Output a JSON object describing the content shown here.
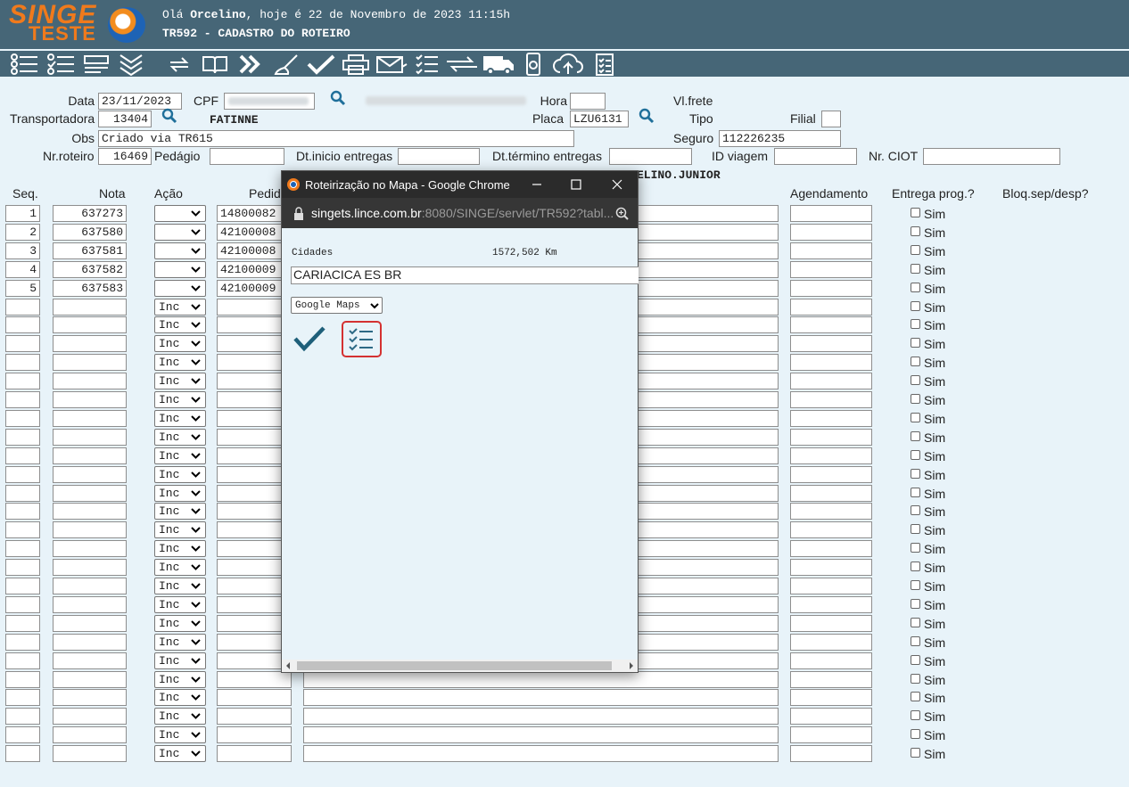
{
  "header": {
    "logo_top": "SINGE",
    "logo_bottom": "TESTE",
    "greeting_prefix": "Olá ",
    "user": "Orcelino",
    "greeting_suffix": ", hoje é 22 de Novembro de 2023 11:15h",
    "screen_title": "TR592 - CADASTRO DO ROTEIRO"
  },
  "toolbar": {
    "icons": [
      "list-icon",
      "checklist-icon",
      "form-icon",
      "chevrons-down-icon",
      "refresh-icon",
      "book-icon",
      "fast-forward-icon",
      "broom-icon",
      "check-icon",
      "printer-icon",
      "email-icon",
      "task-list-icon",
      "transfer-icon",
      "truck-icon",
      "phone-icon",
      "cloud-upload-icon",
      "clipboard-list-icon"
    ]
  },
  "form": {
    "data_label": "Data",
    "data_value": "23/11/2023",
    "cpf_label": "CPF",
    "hora_label": "Hora",
    "vl_frete_label": "Vl.frete",
    "transportadora_label": "Transportadora",
    "transportadora_value": "13404",
    "transportadora_name": "FATINNE",
    "placa_label": "Placa",
    "placa_value": "LZU6131",
    "tipo_label": "Tipo",
    "filial_label": "Filial",
    "obs_label": "Obs",
    "obs_value": "Criado via TR615",
    "seguro_label": "Seguro",
    "seguro_value": "112226235",
    "nr_roteiro_label": "Nr.roteiro",
    "nr_roteiro_value": "16469",
    "pedagio_label": "Pedágio",
    "dt_inicio_label": "Dt.inicio entregas",
    "dt_termino_label": "Dt.término entregas",
    "id_viagem_label": "ID viagem",
    "nr_ciot_label": "Nr. CIOT",
    "user_fragment": "ELINO.JUNIOR"
  },
  "table": {
    "headers": {
      "seq": "Seq.",
      "nota": "Nota",
      "acao": "Ação",
      "pedido": "Pedid",
      "agendamento": "Agendamento",
      "entrega_prog": "Entrega prog.?",
      "bloq": "Bloq.sep/desp?"
    },
    "filled_rows": [
      {
        "seq": "1",
        "nota": "637273",
        "pedido": "14800082"
      },
      {
        "seq": "2",
        "nota": "637580",
        "pedido": "42100008"
      },
      {
        "seq": "3",
        "nota": "637581",
        "pedido": "42100008"
      },
      {
        "seq": "4",
        "nota": "637582",
        "pedido": "42100009"
      },
      {
        "seq": "5",
        "nota": "637583",
        "pedido": "42100009"
      }
    ],
    "empty_action": "Inc",
    "sim_label": "Sim",
    "total_rows": 30
  },
  "popup": {
    "window_title": "Roteirização no Mapa - Google Chrome",
    "url_host": "singets.lince.com.br",
    "url_rest": ":8080/SINGE/servlet/TR592?tabl...",
    "cidades_label": "Cidades",
    "distance": "1572,502 Km",
    "city_value": "CARIACICA ES BR",
    "map_select": "Google Maps",
    "icons": [
      "confirm-check-icon",
      "route-list-icon"
    ]
  }
}
